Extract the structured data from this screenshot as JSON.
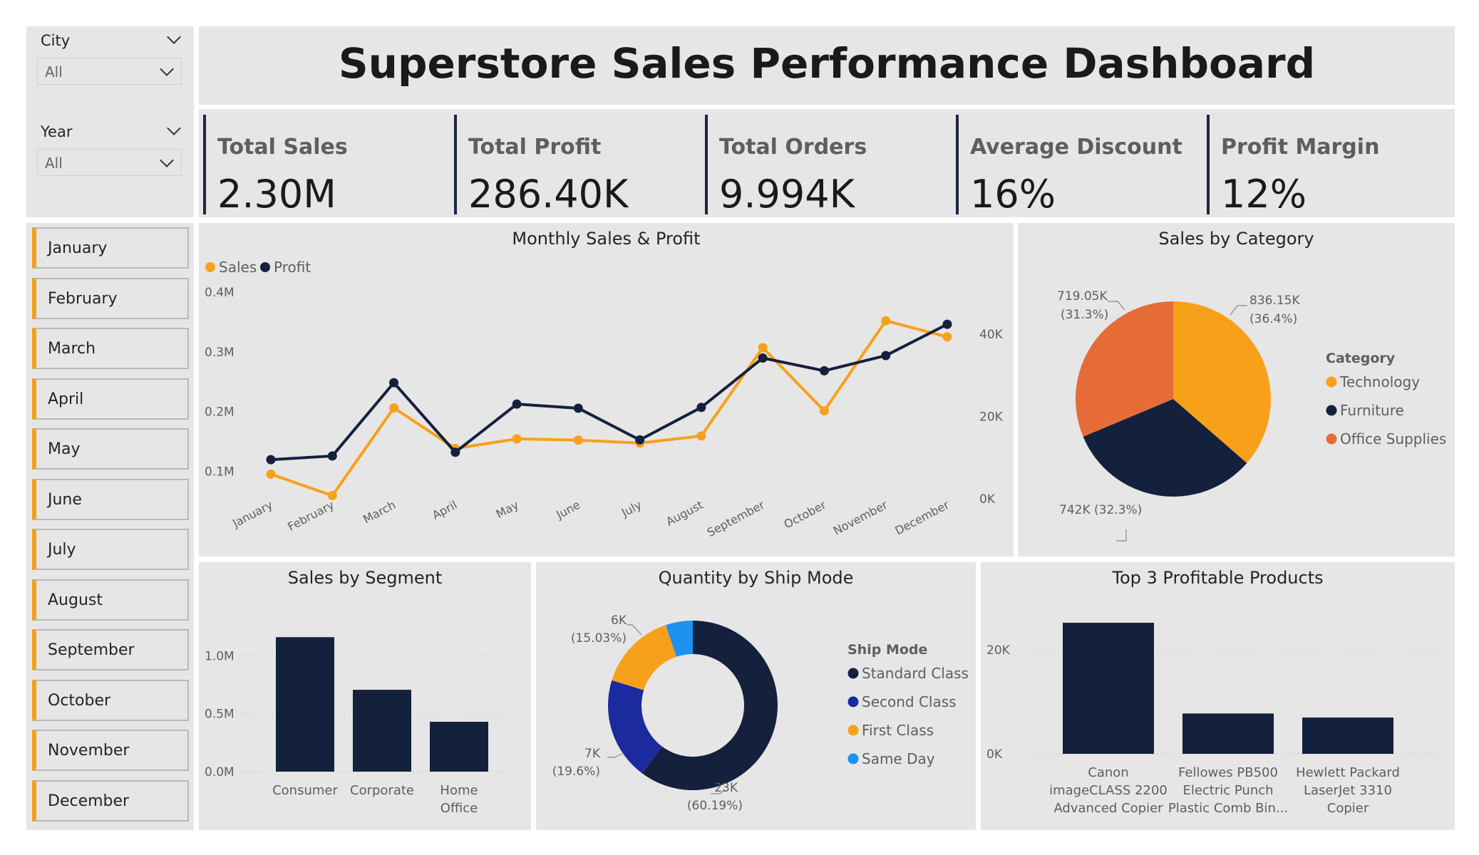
{
  "header": {
    "title": "Superstore Sales Performance Dashboard"
  },
  "filters": {
    "city": {
      "label": "City",
      "value": "All"
    },
    "year": {
      "label": "Year",
      "value": "All"
    }
  },
  "months": [
    "January",
    "February",
    "March",
    "April",
    "May",
    "June",
    "July",
    "August",
    "September",
    "October",
    "November",
    "December"
  ],
  "kpis": [
    {
      "label": "Total Sales",
      "value": "2.30M"
    },
    {
      "label": "Total Profit",
      "value": "286.40K"
    },
    {
      "label": "Total Orders",
      "value": "9.994K"
    },
    {
      "label": "Average Discount",
      "value": "16%"
    },
    {
      "label": "Profit Margin",
      "value": "12%"
    }
  ],
  "colors": {
    "navy": "#14213d",
    "orange": "#f7a11a",
    "red_orange": "#e66c37",
    "blue": "#1b2a9e",
    "light_blue": "#1d91f0",
    "panel": "#e6e6e6"
  },
  "chart_data": [
    {
      "id": "monthly",
      "type": "line",
      "title": "Monthly Sales & Profit",
      "legend": "top-left",
      "x": [
        "January",
        "February",
        "March",
        "April",
        "May",
        "June",
        "July",
        "August",
        "September",
        "October",
        "November",
        "December"
      ],
      "series": [
        {
          "name": "Sales",
          "axis": "left",
          "color": "#f7a11a",
          "values": [
            0.095,
            0.059,
            0.206,
            0.138,
            0.154,
            0.152,
            0.147,
            0.159,
            0.307,
            0.201,
            0.352,
            0.325
          ]
        },
        {
          "name": "Profit",
          "axis": "right",
          "color": "#14213d",
          "values": [
            9500,
            10400,
            28200,
            11300,
            23000,
            22000,
            14300,
            22200,
            34200,
            31100,
            34800,
            42400
          ]
        }
      ],
      "y_left": {
        "ticks": [
          "0.1M",
          "0.2M",
          "0.3M",
          "0.4M"
        ],
        "tick_values": [
          0.1,
          0.2,
          0.3,
          0.4
        ],
        "range": [
          0,
          0.43
        ]
      },
      "y_right": {
        "ticks": [
          "0K",
          "20K",
          "40K"
        ],
        "tick_values": [
          0,
          20000,
          40000
        ],
        "range": [
          0,
          57000
        ]
      }
    },
    {
      "id": "category",
      "type": "pie",
      "title": "Sales by Category",
      "legend_title": "Category",
      "slices": [
        {
          "name": "Technology",
          "value": 836150,
          "label": "836.15K",
          "pct": "(36.4%)",
          "color": "#f7a11a"
        },
        {
          "name": "Furniture",
          "value": 742000,
          "label": "742K (32.3%)",
          "pct": "",
          "color": "#14213d"
        },
        {
          "name": "Office Supplies",
          "value": 719050,
          "label": "719.05K",
          "pct": "(31.3%)",
          "color": "#e66c37"
        }
      ]
    },
    {
      "id": "segment",
      "type": "bar",
      "title": "Sales by Segment",
      "categories": [
        [
          "Consumer"
        ],
        [
          "Corporate"
        ],
        [
          "Home",
          "Office"
        ]
      ],
      "values": [
        1160000,
        706000,
        430000
      ],
      "y_ticks": [
        "0.0M",
        "0.5M",
        "1.0M"
      ],
      "y_tick_values": [
        0,
        500000,
        1000000
      ],
      "ylim": [
        0,
        1260000
      ],
      "color": "#14213d"
    },
    {
      "id": "shipmode",
      "type": "pie",
      "title": "Quantity by Ship Mode",
      "legend_title": "Ship Mode",
      "slices": [
        {
          "name": "Standard Class",
          "value": 60.19,
          "label": "23K",
          "pct": "(60.19%)",
          "color": "#14213d"
        },
        {
          "name": "Second Class",
          "value": 19.6,
          "label": "7K",
          "pct": "(19.6%)",
          "color": "#1b2a9e"
        },
        {
          "name": "First Class",
          "value": 15.03,
          "label": "6K",
          "pct": "(15.03%)",
          "color": "#f7a11a"
        },
        {
          "name": "Same Day",
          "value": 5.18,
          "label": "",
          "pct": "",
          "color": "#1d91f0"
        }
      ]
    },
    {
      "id": "products",
      "type": "bar",
      "title": "Top 3 Profitable Products",
      "categories": [
        [
          "Canon",
          "imageCLASS 2200",
          "Advanced Copier"
        ],
        [
          "Fellowes PB500",
          "Electric Punch",
          "Plastic Comb Bin..."
        ],
        [
          "Hewlett Packard",
          "LaserJet 3310",
          "Copier"
        ]
      ],
      "values": [
        25200,
        7750,
        6980
      ],
      "y_ticks": [
        "0K",
        "20K"
      ],
      "y_tick_values": [
        0,
        20000
      ],
      "ylim": [
        0,
        28000
      ],
      "color": "#14213d"
    }
  ]
}
